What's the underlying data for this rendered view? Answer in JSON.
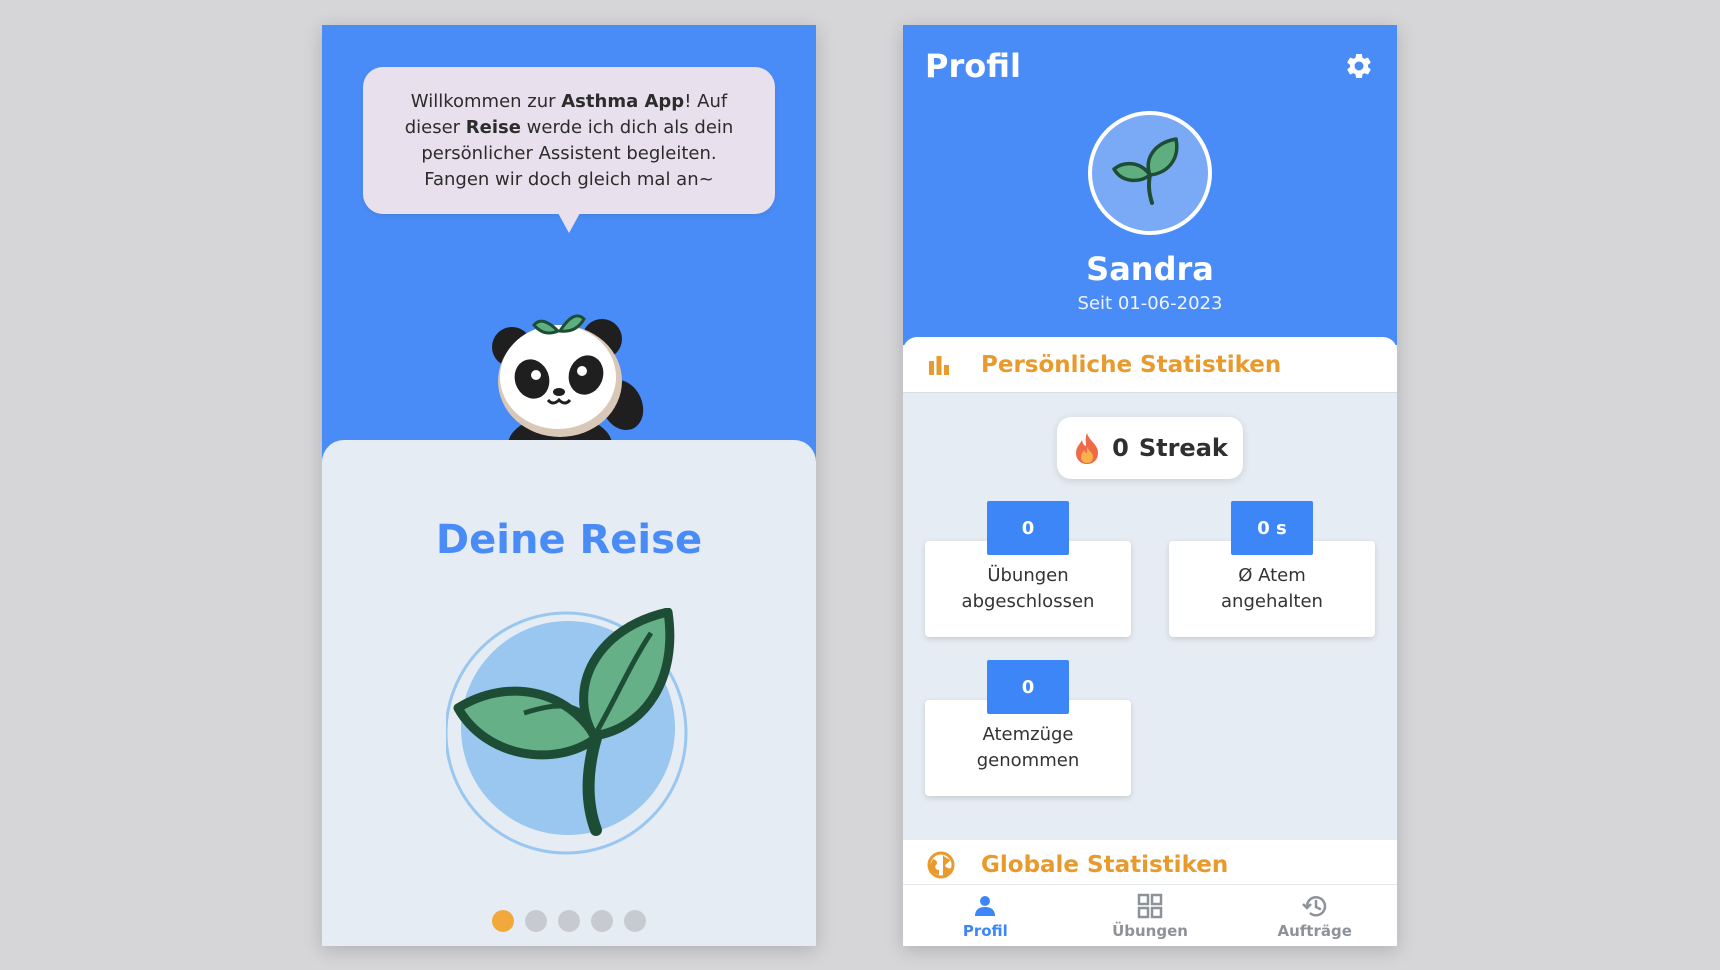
{
  "onboarding": {
    "bubble": {
      "part1": "Willkommen zur ",
      "app_name": "Asthma App",
      "part2": "! Auf dieser ",
      "reise": "Reise",
      "part3": " werde ich dich als dein persönlicher Assistent begleiten. Fangen wir doch gleich mal an~"
    },
    "title": "Deine Reise",
    "pagination": {
      "total": 5,
      "active_index": 0
    },
    "mascot_icon": "panda-icon",
    "illustration_icon": "sprout-icon"
  },
  "profile": {
    "title": "Profil",
    "settings_icon": "gear-icon",
    "username": "Sandra",
    "since": "Seit 01-06-2023",
    "personal_stats": {
      "heading": "Persönliche Statistiken",
      "streak_value": "0",
      "streak_label": "Streak",
      "items": [
        {
          "value": "0",
          "label": "Übungen\nabgeschlossen"
        },
        {
          "value": "0 s",
          "label": "Ø Atem\nangehalten"
        },
        {
          "value": "0",
          "label": "Atemzüge\ngenommen"
        }
      ]
    },
    "global_stats": {
      "heading": "Globale Statistiken"
    }
  },
  "tabbar": {
    "tabs": [
      {
        "label": "Profil",
        "icon": "person-icon",
        "active": true
      },
      {
        "label": "Übungen",
        "icon": "grid-icon",
        "active": false
      },
      {
        "label": "Aufträge",
        "icon": "history-icon",
        "active": false
      }
    ]
  },
  "colors": {
    "primary_blue": "#4a8cf7",
    "accent_orange": "#e99a2c",
    "dot_active": "#f2a93b",
    "background": "#e6ecf3"
  }
}
